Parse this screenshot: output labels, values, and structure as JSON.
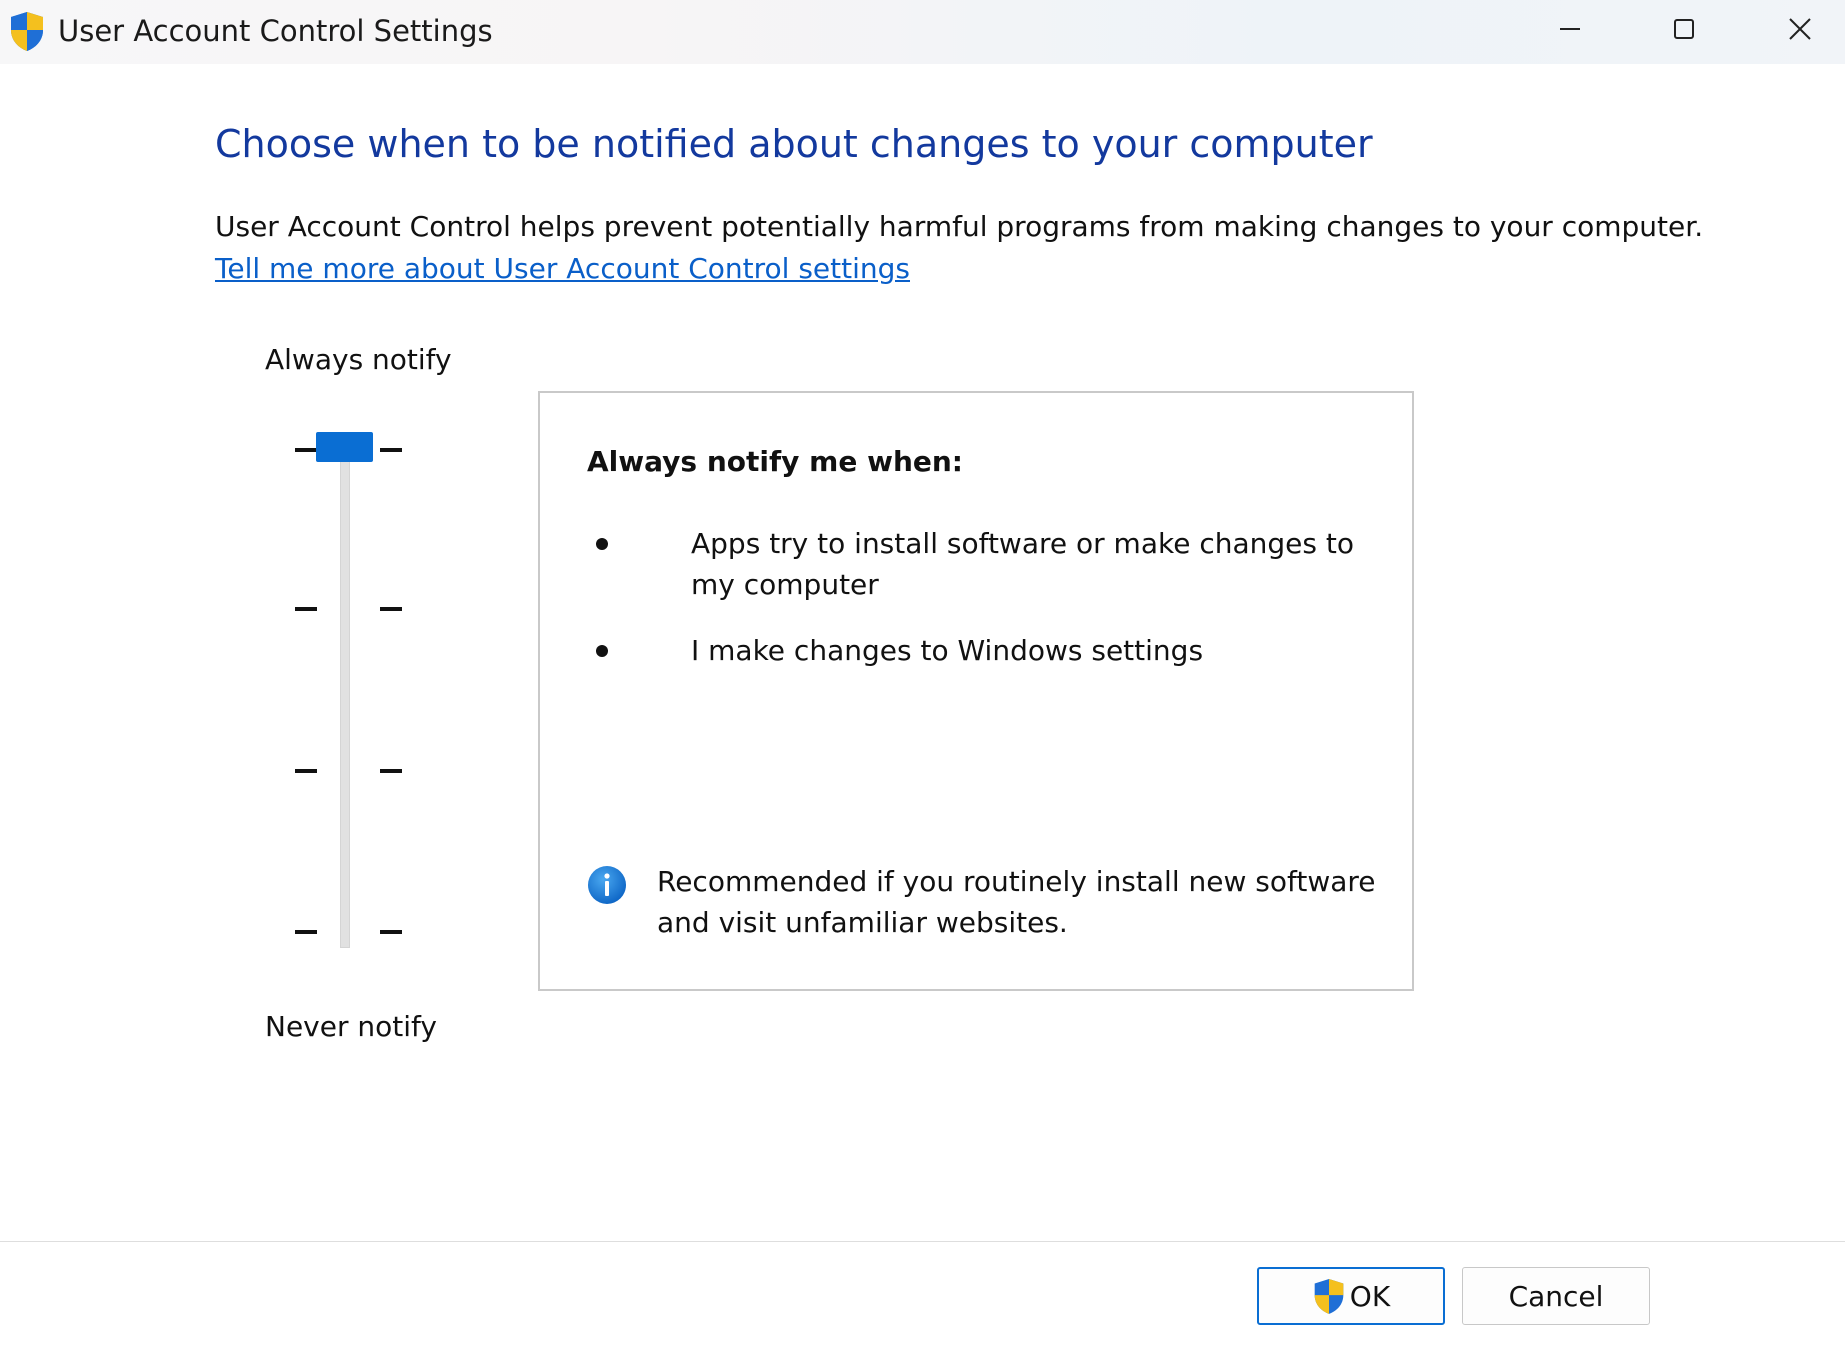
{
  "window": {
    "title": "User Account Control Settings",
    "icon": "uac-shield-icon"
  },
  "caption_buttons": {
    "minimize_icon": "minimize-icon",
    "maximize_icon": "maximize-icon",
    "close_icon": "close-icon"
  },
  "main": {
    "heading": "Choose when to be notified about changes to your computer",
    "description": "User Account Control helps prevent potentially harmful programs from making changes to your computer.",
    "help_link": "Tell me more about User Account Control settings"
  },
  "slider": {
    "top_label": "Always notify",
    "bottom_label": "Never notify",
    "levels": 4,
    "selected_level_from_top": 1
  },
  "panel": {
    "title": "Always notify me when:",
    "bullets": [
      "Apps try to install software or make changes to my computer",
      "I make changes to Windows settings"
    ],
    "info_text": "Recommended if you routinely install new software and visit unfamiliar websites.",
    "info_icon": "info-icon"
  },
  "footer": {
    "ok_label": "OK",
    "cancel_label": "Cancel"
  },
  "colors": {
    "heading": "#13399e",
    "link": "#0a5fc9",
    "accent": "#0a6ed3"
  }
}
